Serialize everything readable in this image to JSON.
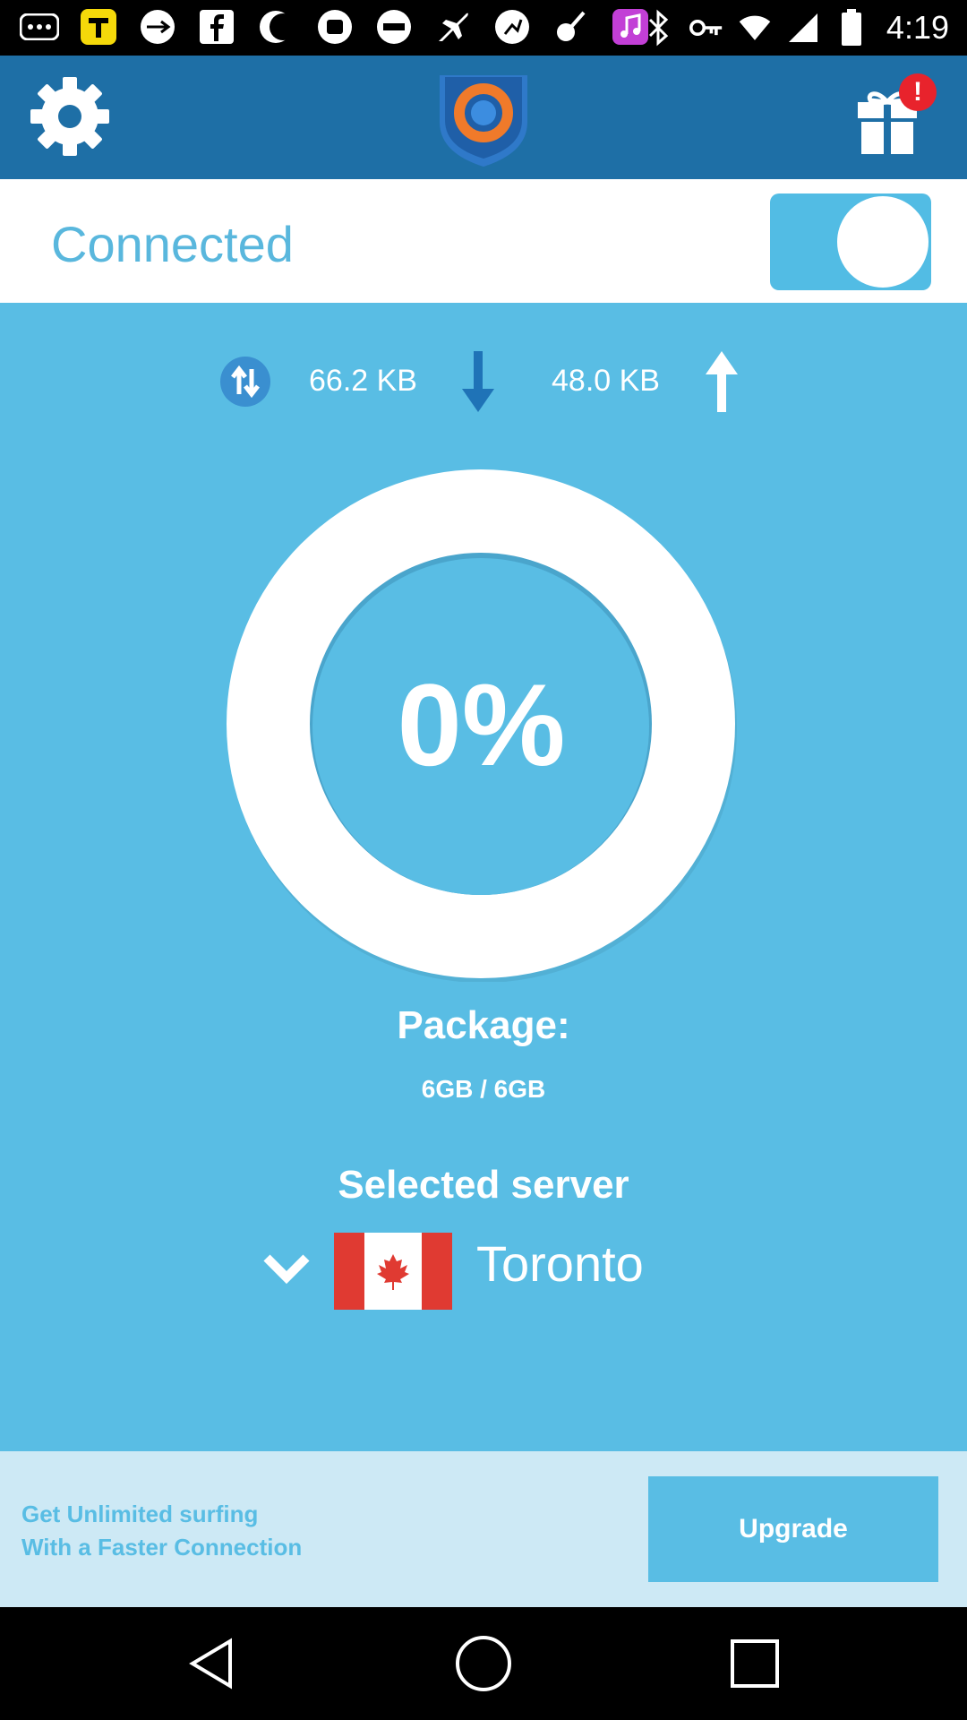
{
  "status_bar": {
    "time": "4:19",
    "left_icons": [
      "more-icon",
      "app-t-icon",
      "usb-icon",
      "facebook-icon",
      "moon-icon",
      "phone-icon",
      "usa-today-icon",
      "plane-icon",
      "fitness-icon",
      "guitar-icon",
      "music-icon"
    ],
    "right_icons": [
      "bluetooth-icon",
      "key-icon",
      "wifi-icon",
      "signal-icon",
      "battery-icon"
    ]
  },
  "header": {
    "brand_colors": {
      "bar": "#1e6fa6",
      "shield": "#2f79c9",
      "ring": "#f07a2a"
    },
    "gift_badge": "!"
  },
  "connection": {
    "status_label": "Connected",
    "toggle_on": true
  },
  "traffic": {
    "download": "66.2 KB",
    "upload": "48.0 KB"
  },
  "usage": {
    "percent_label": "0%",
    "percent_value": 0
  },
  "package": {
    "title": "Package:",
    "value": "6GB / 6GB"
  },
  "server": {
    "title": "Selected server",
    "name": "Toronto",
    "flag": "canada-flag"
  },
  "promo": {
    "line1": "Get Unlimited surfing",
    "line2": "With a Faster Connection",
    "button_label": "Upgrade"
  },
  "colors": {
    "accent": "#59bde4",
    "promo_bg": "#cde9f5"
  }
}
